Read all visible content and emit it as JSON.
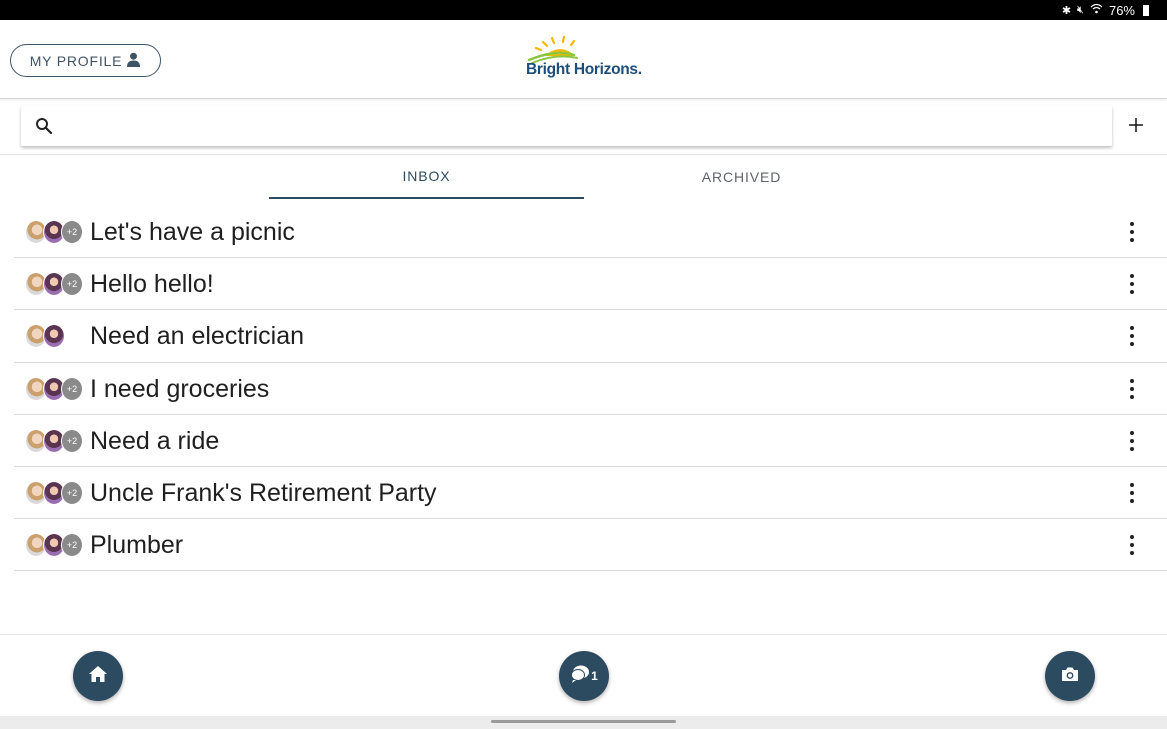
{
  "status_bar": {
    "battery": "76%"
  },
  "header": {
    "profile_label": "MY PROFILE",
    "logo_text": "Bright Horizons."
  },
  "search": {
    "value": "",
    "placeholder": ""
  },
  "tabs": [
    {
      "label": "INBOX",
      "active": true
    },
    {
      "label": "ARCHIVED",
      "active": false
    }
  ],
  "conversations": [
    {
      "title": "Let's have a picnic",
      "extra_participants": "+2"
    },
    {
      "title": "Hello hello!",
      "extra_participants": "+2"
    },
    {
      "title": "Need an electrician",
      "extra_participants": ""
    },
    {
      "title": "I need groceries",
      "extra_participants": "+2"
    },
    {
      "title": "Need a ride",
      "extra_participants": "+2"
    },
    {
      "title": "Uncle Frank's Retirement Party",
      "extra_participants": "+2"
    },
    {
      "title": "Plumber",
      "extra_participants": "+2"
    }
  ],
  "bottom_nav": {
    "messages_badge": "1"
  },
  "colors": {
    "accent": "#2c4a60",
    "logo_blue": "#1d4e7a",
    "sun_yellow": "#f5b800",
    "sun_green": "#8cc63f"
  },
  "icons": [
    "search-icon",
    "add-icon",
    "person-icon",
    "more-vert-icon",
    "home-icon",
    "chat-icon",
    "camera-icon"
  ]
}
